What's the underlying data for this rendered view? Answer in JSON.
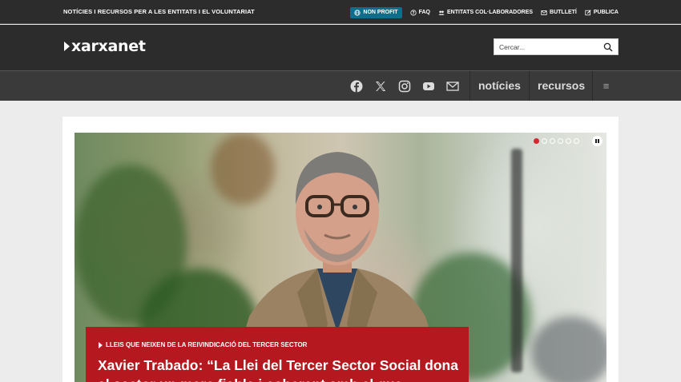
{
  "topbar": {
    "tagline": "NOTÍCIES I RECURSOS PER A LES ENTITATS I EL VOLUNTARIAT",
    "links": [
      {
        "label": "NON PROFIT",
        "icon": "globe-icon"
      },
      {
        "label": "FAQ",
        "icon": "question-icon"
      },
      {
        "label": "ENTITATS COL·LABORADORES",
        "icon": "users-icon"
      },
      {
        "label": "BUTLLETÍ",
        "icon": "envelope-icon"
      },
      {
        "label": "PUBLICA",
        "icon": "edit-icon"
      }
    ]
  },
  "logo": {
    "text": "xarxanet"
  },
  "search": {
    "placeholder": "Cercar..."
  },
  "nav": {
    "social": [
      "facebook-icon",
      "x-icon",
      "instagram-icon",
      "youtube-icon",
      "mail-icon"
    ],
    "items": [
      "notícies",
      "recursos"
    ],
    "menu_glyph": "≡"
  },
  "slider": {
    "slides": 6,
    "active": 1
  },
  "hero": {
    "kicker": "LLEIS QUE NEIXEN DE LA REIVINDICACIÓ DEL TERCER SECTOR",
    "headline": "Xavier Trabado: “La Llei del Tercer Sector Social dona al sector un marc fiable i coherent amb el que"
  },
  "colors": {
    "dark": "#2c2c2c",
    "nav": "#3a3a3a",
    "accent": "#b5181f",
    "nonprofit": "#0e6f8c"
  }
}
